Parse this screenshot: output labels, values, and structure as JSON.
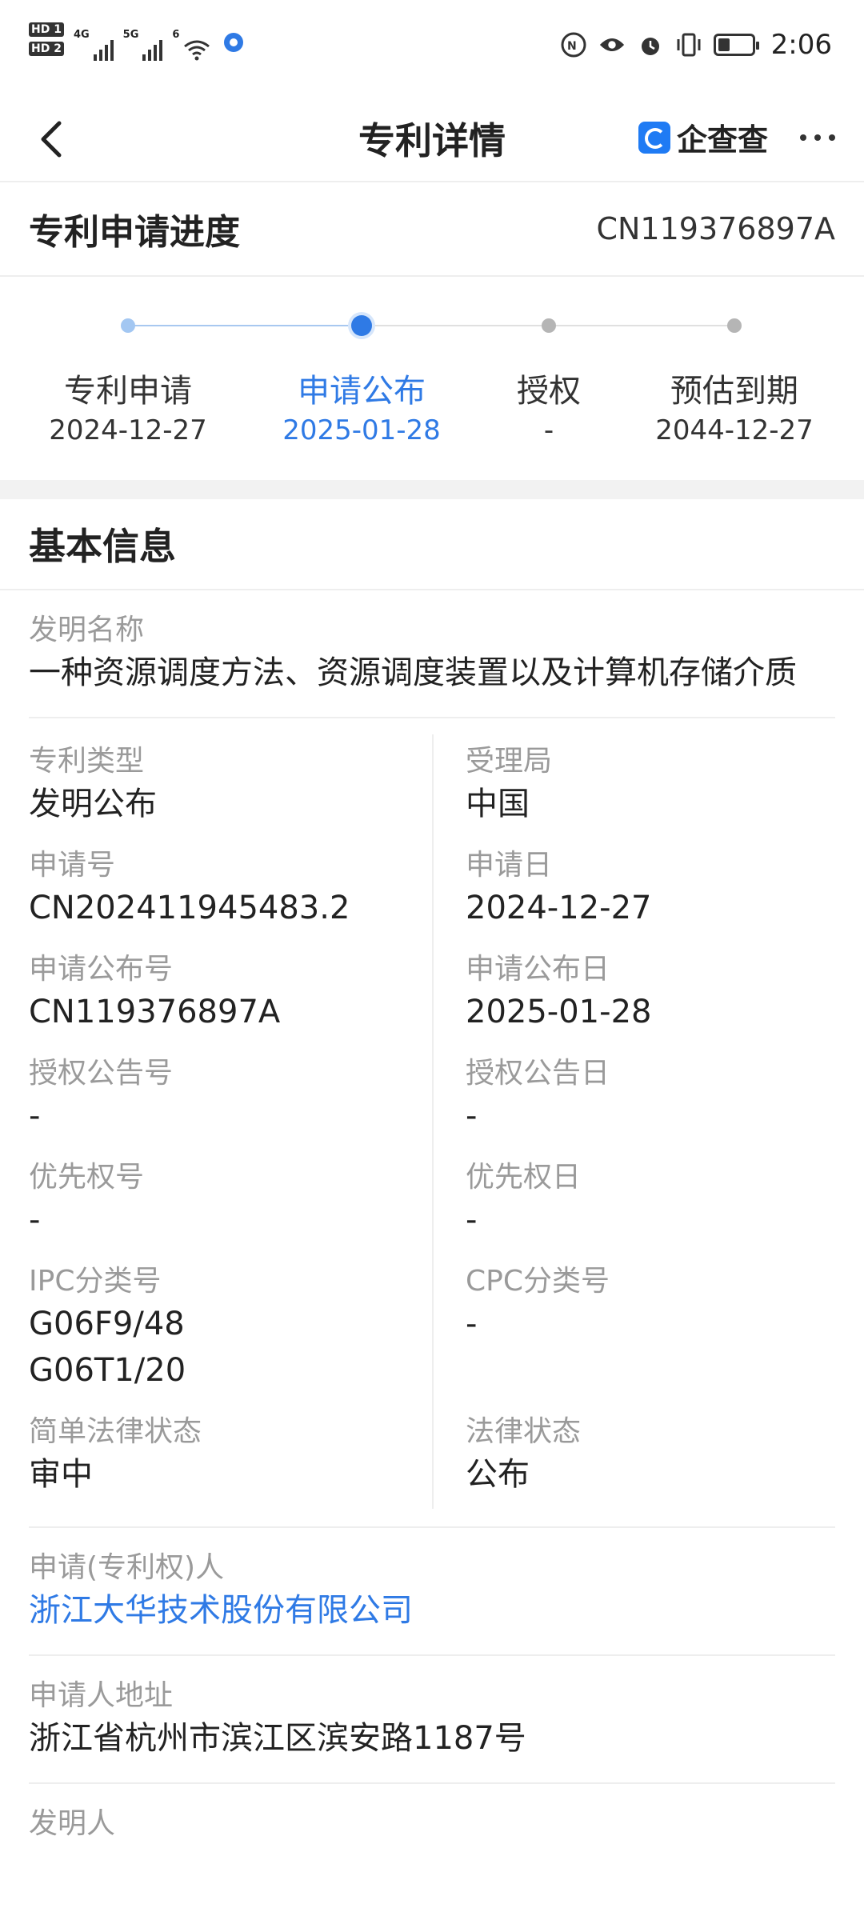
{
  "status_bar": {
    "sim1": "HD 1",
    "sim2": "HD 2",
    "net1": "4G",
    "net2": "5G",
    "wifi": "6",
    "time": "2:06",
    "battery_level": 0.35
  },
  "nav": {
    "title": "专利详情",
    "brand": "企查查"
  },
  "progress": {
    "heading": "专利申请进度",
    "patent_number": "CN119376897A",
    "steps": [
      {
        "label": "专利申请",
        "date": "2024-12-27"
      },
      {
        "label": "申请公布",
        "date": "2025-01-28"
      },
      {
        "label": "授权",
        "date": "-"
      },
      {
        "label": "预估到期",
        "date": "2044-12-27"
      }
    ]
  },
  "basic": {
    "heading": "基本信息",
    "invention_name_label": "发明名称",
    "invention_name": "一种资源调度方法、资源调度装置以及计算机存储介质",
    "rows": [
      {
        "l_label": "专利类型",
        "l_value": "发明公布",
        "r_label": "受理局",
        "r_value": "中国"
      },
      {
        "l_label": "申请号",
        "l_value": "CN202411945483.2",
        "r_label": "申请日",
        "r_value": "2024-12-27"
      },
      {
        "l_label": "申请公布号",
        "l_value": "CN119376897A",
        "r_label": "申请公布日",
        "r_value": "2025-01-28"
      },
      {
        "l_label": "授权公告号",
        "l_value": "-",
        "r_label": "授权公告日",
        "r_value": "-"
      },
      {
        "l_label": "优先权号",
        "l_value": "-",
        "r_label": "优先权日",
        "r_value": "-"
      },
      {
        "l_label": "IPC分类号",
        "l_value": "G06F9/48",
        "l_value2": "G06T1/20",
        "r_label": "CPC分类号",
        "r_value": "-"
      },
      {
        "l_label": "简单法律状态",
        "l_value": "审中",
        "r_label": "法律状态",
        "r_value": "公布"
      }
    ],
    "applicant_label": "申请(专利权)人",
    "applicant": "浙江大华技术股份有限公司",
    "address_label": "申请人地址",
    "address": "浙江省杭州市滨江区滨安路1187号",
    "inventor_label": "发明人"
  }
}
